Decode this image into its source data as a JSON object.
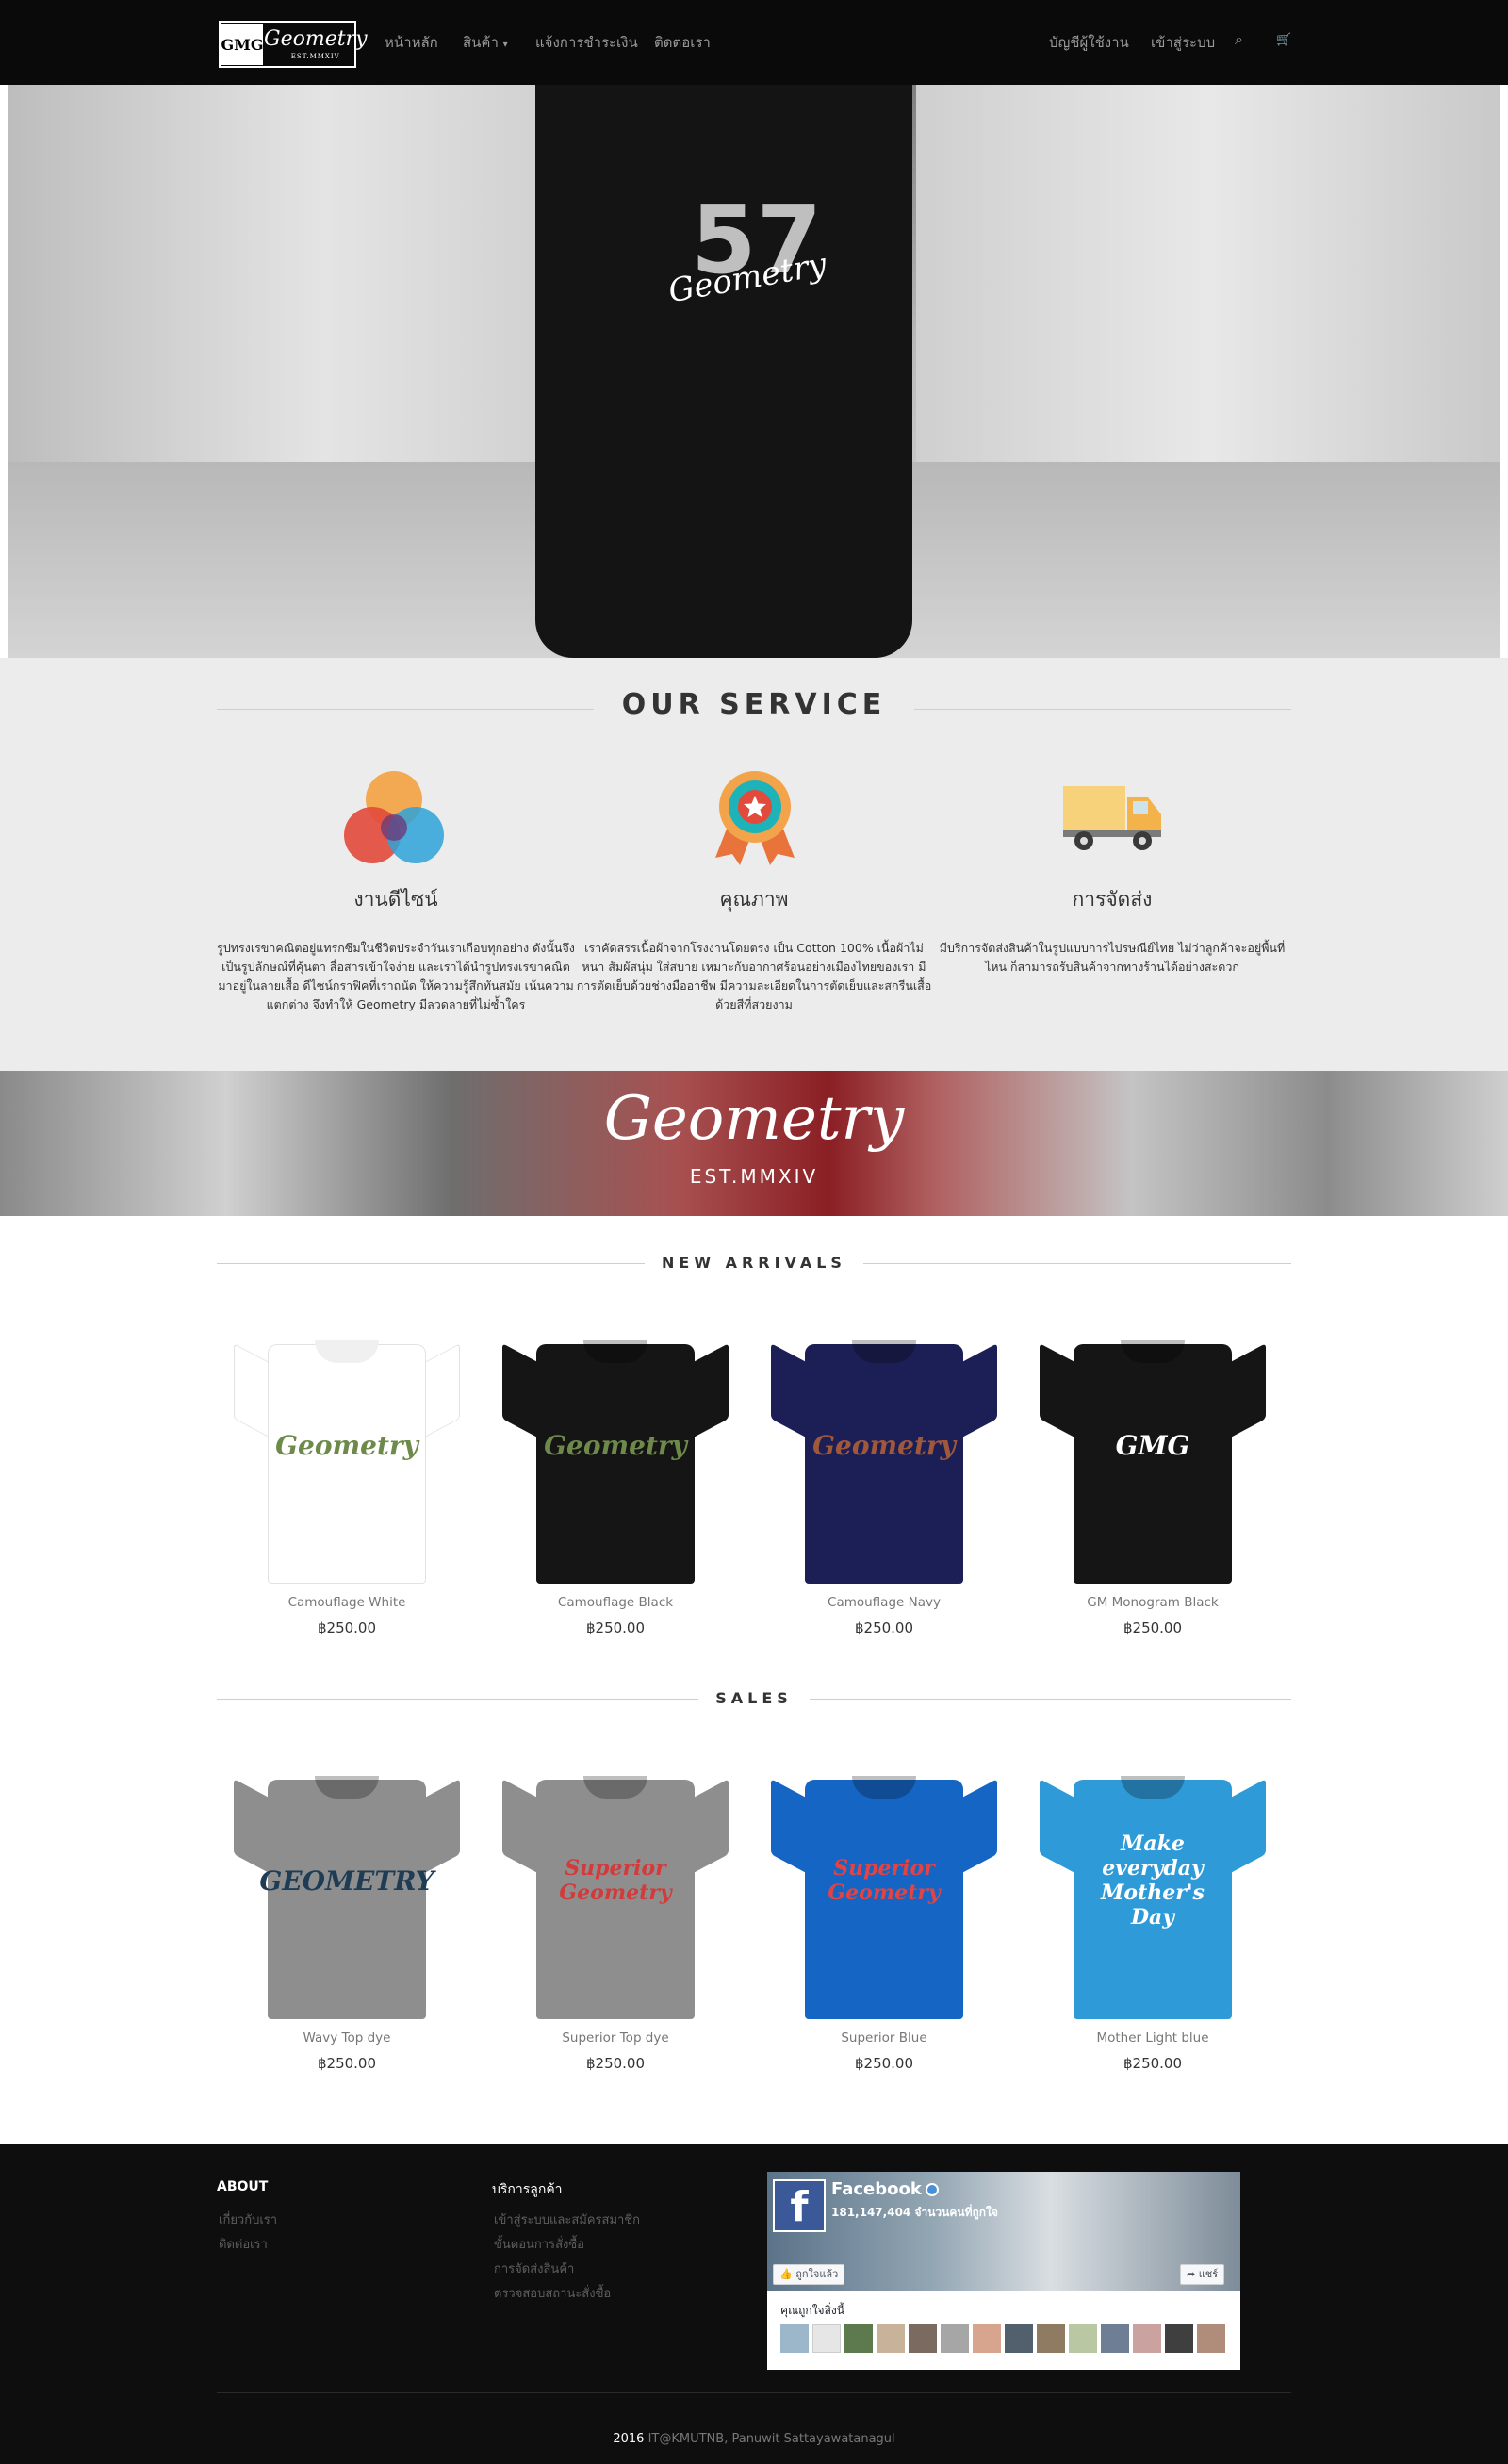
{
  "brand": {
    "mark": "GMG",
    "name": "Geometry",
    "est": "EST.MMXIV"
  },
  "nav": {
    "items": [
      {
        "label": "หน้าหลัก"
      },
      {
        "label": "สินค้า",
        "caret": "▾"
      },
      {
        "label": "แจ้งการชำระเงิน"
      },
      {
        "label": "ติดต่อเรา"
      }
    ],
    "account": "บัญชีผู้ใช้งาน",
    "login": "เข้าสู่ระบบ",
    "search_icon": "⌕",
    "cart_icon": "🛒"
  },
  "hero": {
    "print_number": "57",
    "print_script": "Geometry"
  },
  "service": {
    "title": "OUR SERVICE",
    "items": [
      {
        "icon": "color-circles-icon",
        "name": "งานดีไซน์",
        "desc": "รูปทรงเรขาคณิตอยู่แทรกซึมในชีวิตประจำวันเราเกือบทุกอย่าง ดังนั้นจึงเป็นรูปลักษณ์ที่คุ้นตา สื่อสารเข้าใจง่าย และเราได้นำรูปทรงเรขาคณิตมาอยู่ในลายเสื้อ ดีไซน์กราฟิคที่เราถนัด ให้ความรู้สึกทันสมัย เน้นความแตกต่าง จึงทำให้ Geometry มีลวดลายที่ไม่ซ้ำใคร"
      },
      {
        "icon": "quality-badge-icon",
        "name": "คุณภาพ",
        "desc": "เราคัดสรรเนื้อผ้าจากโรงงานโดยตรง เป็น Cotton 100% เนื้อผ้าไม่หนา สัมผัสนุ่ม ใส่สบาย เหมาะกับอากาศร้อนอย่างเมืองไทยของเรา มีการตัดเย็บด้วยช่างมืออาชีพ มีความละเอียดในการตัดเย็บและสกรีนเสื้อด้วยสีที่สวยงาม"
      },
      {
        "icon": "delivery-truck-icon",
        "name": "การจัดส่ง",
        "desc": "มีบริการจัดส่งสินค้าในรูปแบบการไปรษณีย์ไทย ไม่ว่าลูกค้าจะอยู่พื้นที่ไหน ก็สามารถรับสินค้าจากทางร้านได้อย่างสะดวก"
      }
    ],
    "colors": {
      "red": "#e24a3b",
      "orange": "#f3a44a",
      "blue": "#2da3d8",
      "teal": "#1db3b8",
      "truck": "#f7d27a"
    }
  },
  "banner": {
    "script": "Geometry",
    "est": "EST.MMXIV"
  },
  "new_arrivals": {
    "title": "NEW ARRIVALS",
    "products": [
      {
        "name": "Camouflage White",
        "price": "฿250.00",
        "color": "#ffffff",
        "print": "Geometry",
        "print_color": "#6e8a4a"
      },
      {
        "name": "Camouflage Black",
        "price": "฿250.00",
        "color": "#151515",
        "print": "Geometry",
        "print_color": "#6e8a4a"
      },
      {
        "name": "Camouflage Navy",
        "price": "฿250.00",
        "color": "#1c1f55",
        "print": "Geometry",
        "print_color": "#a0573a"
      },
      {
        "name": "GM Monogram Black",
        "price": "฿250.00",
        "color": "#151515",
        "print": "GMG",
        "print_color": "#ffffff"
      }
    ]
  },
  "sales": {
    "title": "SALES",
    "products": [
      {
        "name": "Wavy Top dye",
        "price": "฿250.00",
        "color": "#8e8e8e",
        "print": "GEOMETRY",
        "print_color": "#1f3c55"
      },
      {
        "name": "Superior Top dye",
        "price": "฿250.00",
        "color": "#8e8e8e",
        "print": "Superior Geometry",
        "print_color": "#d33a3a"
      },
      {
        "name": "Superior Blue",
        "price": "฿250.00",
        "color": "#1566c4",
        "print": "Superior Geometry",
        "print_color": "#e34343"
      },
      {
        "name": "Mother Light blue",
        "price": "฿250.00",
        "color": "#2e9ad8",
        "print": "Make everyday Mother's Day",
        "print_color": "#ffffff"
      }
    ]
  },
  "footer": {
    "about_title": "ABOUT",
    "about_links": [
      "เกี่ยวกับเรา",
      "ติดต่อเรา"
    ],
    "service_title": "บริการลูกค้า",
    "service_links": [
      "เข้าสู่ระบบและสมัครสมาชิก",
      "ขั้นตอนการสั่งซื้อ",
      "การจัดส่งสินค้า",
      "ตรวจสอบสถานะสั่งซื้อ"
    ],
    "facebook": {
      "title": "Facebook",
      "likes": "181,147,404 จำนวนคนที่ถูกใจ",
      "liked_label": "ถูกใจแล้ว",
      "share_label": "แชร์",
      "friends_label": "คุณถูกใจสิ่งนี้"
    },
    "copyright_year": "2016",
    "copyright_org": "IT@KMUTNB",
    "copyright_author": ", Panuwit Sattayawatanagul"
  }
}
